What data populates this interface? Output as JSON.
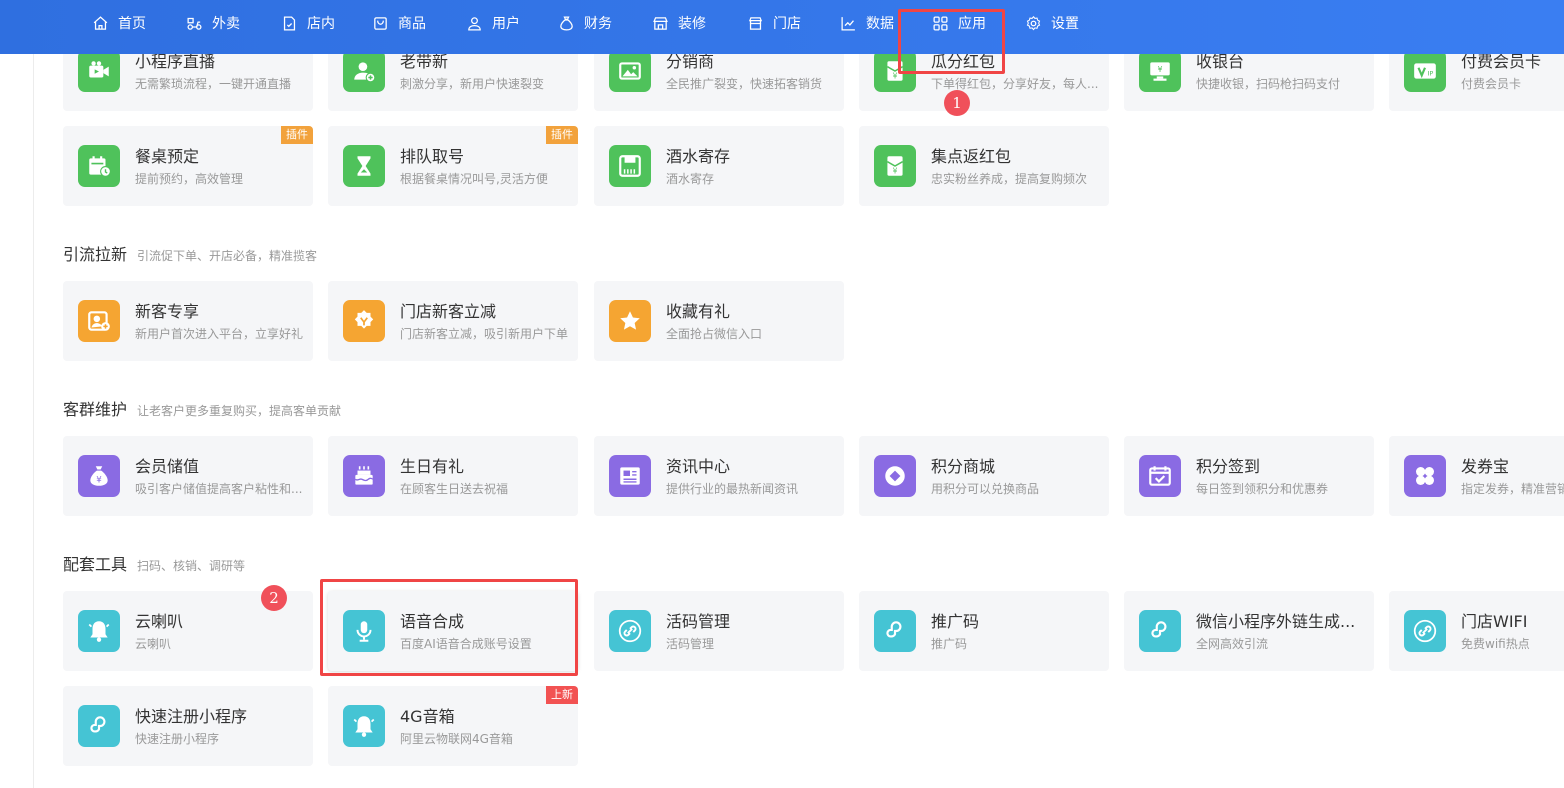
{
  "nav": {
    "items": [
      {
        "label": "首页",
        "icon": "home-icon"
      },
      {
        "label": "外卖",
        "icon": "takeout-icon"
      },
      {
        "label": "店内",
        "icon": "dine-in-icon"
      },
      {
        "label": "商品",
        "icon": "goods-icon"
      },
      {
        "label": "用户",
        "icon": "user-icon"
      },
      {
        "label": "财务",
        "icon": "finance-icon"
      },
      {
        "label": "装修",
        "icon": "decorate-icon"
      },
      {
        "label": "门店",
        "icon": "store-icon"
      },
      {
        "label": "数据",
        "icon": "chart-icon"
      },
      {
        "label": "应用",
        "icon": "apps-icon"
      },
      {
        "label": "设置",
        "icon": "gear-icon"
      }
    ],
    "active": "应用"
  },
  "rows": {
    "top": [
      {
        "title": "小程序直播",
        "desc": "无需繁琐流程，一键开通直播"
      },
      {
        "title": "老带新",
        "desc": "刺激分享，新用户快速裂变"
      },
      {
        "title": "分销商",
        "desc": "全民推广裂变，快速拓客销货"
      },
      {
        "title": "瓜分红包",
        "desc": "下单得红包，分享好友，每人..."
      },
      {
        "title": "收银台",
        "desc": "快捷收银，扫码枪扫码支付"
      },
      {
        "title": "付费会员卡",
        "desc": "付费会员卡"
      }
    ],
    "second": [
      {
        "title": "餐桌预定",
        "desc": "提前预约，高效管理",
        "badge": "插件"
      },
      {
        "title": "排队取号",
        "desc": "根据餐桌情况叫号,灵活方便",
        "badge": "插件"
      },
      {
        "title": "酒水寄存",
        "desc": "酒水寄存"
      },
      {
        "title": "集点返红包",
        "desc": "忠实粉丝养成，提高复购频次"
      }
    ]
  },
  "sections": {
    "traffic": {
      "title": "引流拉新",
      "subtitle": "引流促下单、开店必备，精准揽客",
      "cards": [
        {
          "title": "新客专享",
          "desc": "新用户首次进入平台，立享好礼"
        },
        {
          "title": "门店新客立减",
          "desc": "门店新客立减，吸引新用户下单"
        },
        {
          "title": "收藏有礼",
          "desc": "全面抢占微信入口"
        }
      ]
    },
    "retention": {
      "title": "客群维护",
      "subtitle": "让老客户更多重复购买，提高客单贡献",
      "cards": [
        {
          "title": "会员储值",
          "desc": "吸引客户储值提高客户粘性和..."
        },
        {
          "title": "生日有礼",
          "desc": "在顾客生日送去祝福"
        },
        {
          "title": "资讯中心",
          "desc": "提供行业的最热新闻资讯"
        },
        {
          "title": "积分商城",
          "desc": "用积分可以兑换商品"
        },
        {
          "title": "积分签到",
          "desc": "每日签到领积分和优惠券"
        },
        {
          "title": "发券宝",
          "desc": "指定发券，精准营销"
        }
      ]
    },
    "tools": {
      "title": "配套工具",
      "subtitle": "扫码、核销、调研等",
      "cards": [
        {
          "title": "云喇叭",
          "desc": "云喇叭"
        },
        {
          "title": "语音合成",
          "desc": "百度AI语音合成账号设置"
        },
        {
          "title": "活码管理",
          "desc": "活码管理"
        },
        {
          "title": "推广码",
          "desc": "推广码"
        },
        {
          "title": "微信小程序外链生成...",
          "desc": "全网高效引流"
        },
        {
          "title": "门店WIFI",
          "desc": "免费wifi热点"
        },
        {
          "title": "快速注册小程序",
          "desc": "快速注册小程序"
        },
        {
          "title": "4G音箱",
          "desc": "阿里云物联网4G音箱",
          "badge": "上新"
        }
      ]
    }
  },
  "annotations": {
    "step1": "1",
    "step2": "2"
  },
  "colors": {
    "nav_bg": "#3a7ef2",
    "green": "#4fc25b",
    "orange": "#f5a532",
    "purple": "#8a6be3",
    "teal": "#45c4d4",
    "highlight": "#f04545"
  }
}
